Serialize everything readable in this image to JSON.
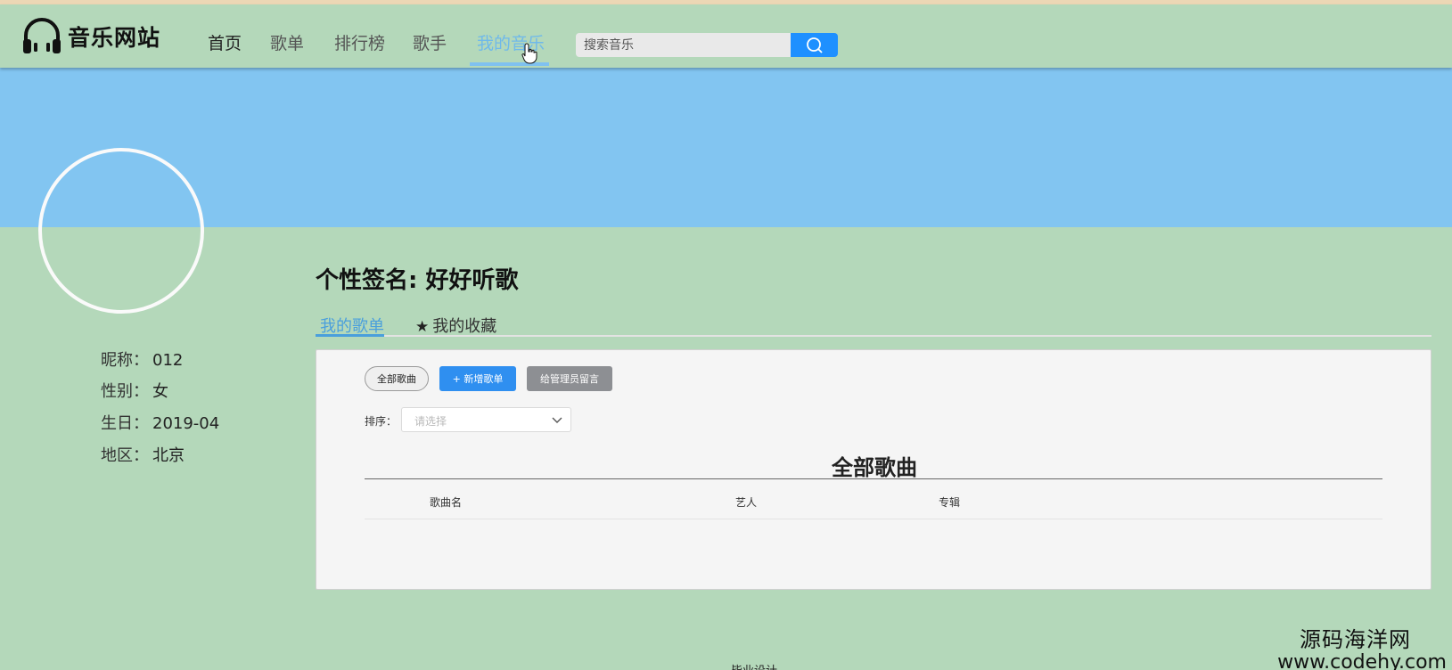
{
  "header": {
    "logo_text": "音乐网站",
    "nav": [
      {
        "label": "首页"
      },
      {
        "label": "歌单"
      },
      {
        "label": "排行榜"
      },
      {
        "label": "歌手"
      },
      {
        "label": "我的音乐"
      }
    ],
    "search_placeholder": "搜索音乐"
  },
  "profile": {
    "nickname_label": "昵称：",
    "nickname": "012",
    "gender_label": "性别：",
    "gender": "女",
    "birthday_label": "生日：",
    "birthday": "2019-04",
    "region_label": "地区：",
    "region": "北京"
  },
  "signature": "个性签名: 好好听歌",
  "tabs": [
    {
      "label": "我的歌单"
    },
    {
      "label": "我的收藏"
    }
  ],
  "panel": {
    "btn_all": "全部歌曲",
    "btn_add": "+ 新增歌单",
    "btn_message": "给管理员留言",
    "sort_label": "排序：",
    "sort_placeholder": "请选择",
    "table_title": "全部歌曲",
    "columns": [
      "歌曲名",
      "艺人",
      "专辑"
    ]
  },
  "watermark": {
    "line1": "源码海洋网",
    "line2": "www.codehy.com"
  },
  "footer": "毕业设计",
  "colors": {
    "page_bg": "#b4d8ba",
    "banner": "#82c5f1",
    "accent": "#1e90ff",
    "active_nav": "#6fb9ea"
  }
}
